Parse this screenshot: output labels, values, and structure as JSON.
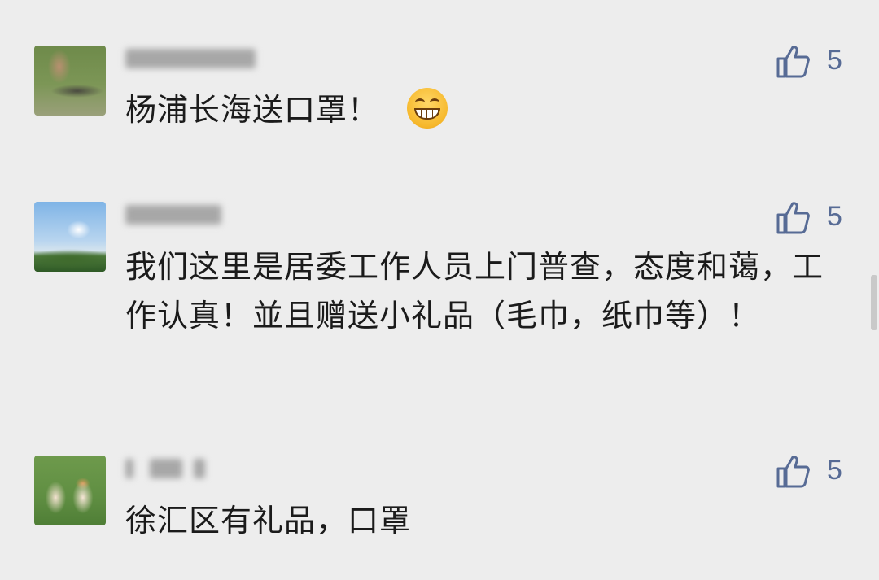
{
  "comments": [
    {
      "author": "",
      "text": "杨浦长海送口罩！",
      "emoji": "grinning-face",
      "likes": "5"
    },
    {
      "author": "",
      "text": "我们这里是居委工作人员上门普查，态度和蔼，工作认真！並且赠送小礼品（毛巾，纸巾等）！",
      "likes": "5"
    },
    {
      "author": "",
      "text": "徐汇区有礼品，口罩",
      "likes": "5"
    }
  ],
  "colors": {
    "background": "#ededed",
    "text": "#1b1b1b",
    "link_blue": "#576b95",
    "blurred_name": "#a7a7a7"
  },
  "icons": {
    "like": "thumbs-up-icon",
    "emoji": "grinning-face-emoji"
  }
}
